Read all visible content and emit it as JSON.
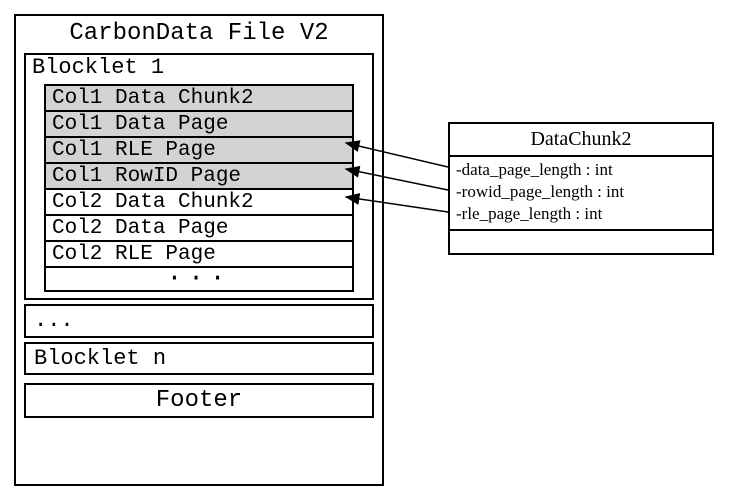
{
  "file": {
    "title": "CarbonData File V2",
    "blocklet1": {
      "title": "Blocklet 1",
      "rows": {
        "r0": "Col1 Data Chunk2",
        "r1": "Col1 Data Page",
        "r2": "Col1 RLE Page",
        "r3": "Col1 RowID Page",
        "r4": "Col2 Data Chunk2",
        "r5": "Col2 Data Page",
        "r6": "Col2 RLE Page",
        "dots": "···"
      }
    },
    "ellipsis": "...",
    "blockletn": "Blocklet n",
    "footer": "Footer"
  },
  "class": {
    "name": "DataChunk2",
    "attrs": {
      "a0": "-data_page_length : int",
      "a1": "-rowid_page_length : int",
      "a2": "-rle_page_length : int"
    }
  }
}
